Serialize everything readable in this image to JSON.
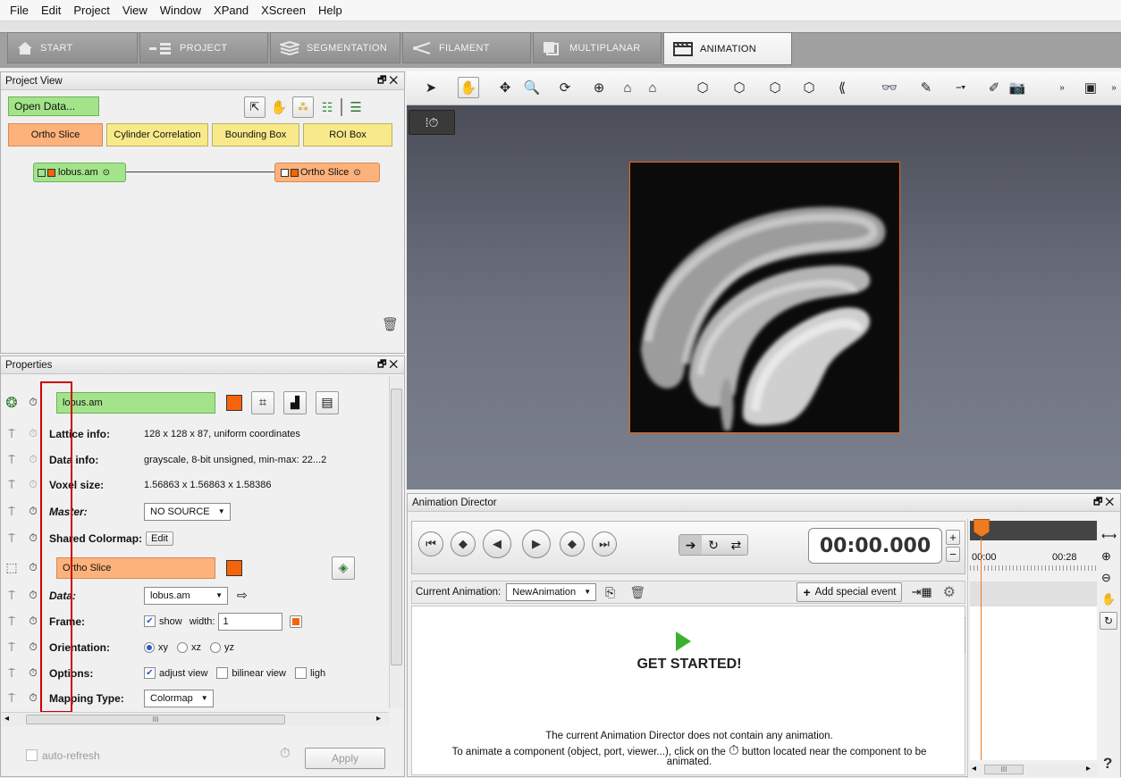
{
  "menu": [
    "File",
    "Edit",
    "Project",
    "View",
    "Window",
    "XPand",
    "XScreen",
    "Help"
  ],
  "tabs": [
    {
      "label": "START",
      "icon": "home-icon"
    },
    {
      "label": "PROJECT",
      "icon": "project-icon"
    },
    {
      "label": "SEGMENTATION",
      "icon": "segmentation-icon"
    },
    {
      "label": "FILAMENT",
      "icon": "filament-icon"
    },
    {
      "label": "MULTIPLANAR",
      "icon": "multiplanar-icon"
    },
    {
      "label": "ANIMATION",
      "icon": "animation-icon"
    }
  ],
  "project_view": {
    "title": "Project View",
    "open_data": "Open Data...",
    "quick": [
      "Ortho Slice",
      "Cylinder Correlation",
      "Bounding Box",
      "ROI Box"
    ],
    "nodes": [
      "lobus.am",
      "Ortho Slice"
    ]
  },
  "properties": {
    "title": "Properties",
    "module1": "lobus.am",
    "module2": "Ortho Slice",
    "rows": {
      "lattice_label": "Lattice info:",
      "lattice_val": "128 x 128 x 87, uniform coordinates",
      "data_label": "Data info:",
      "data_val": "grayscale, 8-bit unsigned, min-max: 22...2",
      "voxel_label": "Voxel size:",
      "voxel_val": "1.56863 x 1.56863 x 1.58386",
      "master_label": "Master:",
      "master_val": "NO SOURCE",
      "shared_label": "Shared Colormap:",
      "shared_val": "Edit",
      "data2_label": "Data:",
      "data2_val": "lobus.am",
      "frame_label": "Frame:",
      "frame_show": "show",
      "frame_width_label": "width:",
      "frame_width": "1",
      "orient_label": "Orientation:",
      "orient_opts": [
        "xy",
        "xz",
        "yz"
      ],
      "options_label": "Options:",
      "opt1": "adjust view",
      "opt2": "bilinear view",
      "opt3": "ligh",
      "mapping_label": "Mapping Type:",
      "mapping_val": "Colormap"
    },
    "auto_refresh": "auto-refresh",
    "apply": "Apply",
    "scroll_mark": "III"
  },
  "animation": {
    "title": "Animation Director",
    "time": "00:00.000",
    "current_label": "Current Animation:",
    "current_val": "NewAnimation",
    "add_event": "Add special event",
    "get_started": "GET STARTED!",
    "desc1": "The current Animation Director does not contain any animation.",
    "desc2a": "To animate a component (object, port, viewer...), click on the",
    "desc2b": "button located near the component to be",
    "desc3": "animated.",
    "timeline_t0": "00:00",
    "timeline_t1": "00:28",
    "scroll_mark": "III"
  },
  "colors": {
    "green_module": "#a3e48a",
    "orange_module": "#fdb27b",
    "accent_orange": "#f5640a",
    "quick_orange": "#fdb27b",
    "quick_yellow": "#f8ea8a",
    "viewer_bg": "#6e7382",
    "highlight_red": "#cc0000"
  }
}
